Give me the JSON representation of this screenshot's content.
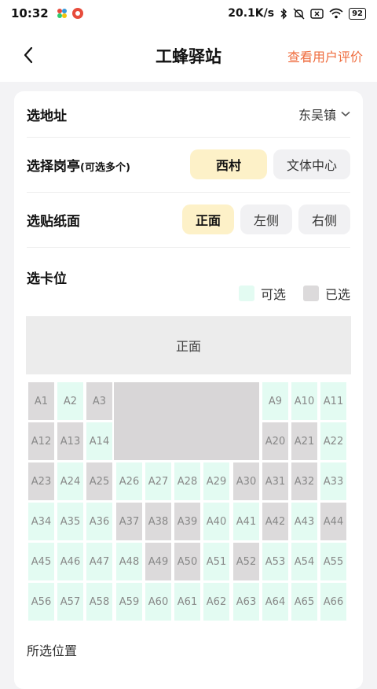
{
  "status": {
    "time": "10:32",
    "speed": "20.1K/s",
    "battery": "92",
    "left_icons": [
      "pinwheel-app-icon",
      "red-app-icon"
    ],
    "right_icons": [
      "bluetooth-icon",
      "mute-bell-icon",
      "close-box-icon",
      "wifi-icon",
      "battery-icon"
    ]
  },
  "nav": {
    "title": "工蜂驿站",
    "action": "查看用户评价"
  },
  "address": {
    "label": "选地址",
    "value": "东吴镇"
  },
  "kiosk": {
    "label": "选择岗亭",
    "hint": "(可选多个)",
    "options": [
      {
        "label": "西村",
        "selected": true
      },
      {
        "label": "文体中心",
        "selected": false
      }
    ]
  },
  "side": {
    "label": "选贴纸面",
    "options": [
      {
        "label": "正面",
        "selected": true
      },
      {
        "label": "左侧",
        "selected": false
      },
      {
        "label": "右侧",
        "selected": false
      }
    ]
  },
  "slots": {
    "label": "选卡位",
    "legend": {
      "available": "可选",
      "taken": "已选"
    },
    "front_label": "正面",
    "cells": [
      {
        "id": "A1",
        "status": "taken"
      },
      {
        "id": "A2",
        "status": "available"
      },
      {
        "id": "A3",
        "status": "taken"
      },
      {
        "id": "A9",
        "status": "available"
      },
      {
        "id": "A10",
        "status": "available"
      },
      {
        "id": "A11",
        "status": "available"
      },
      {
        "id": "A12",
        "status": "taken"
      },
      {
        "id": "A13",
        "status": "taken"
      },
      {
        "id": "A14",
        "status": "available"
      },
      {
        "id": "A20",
        "status": "taken"
      },
      {
        "id": "A21",
        "status": "taken"
      },
      {
        "id": "A22",
        "status": "available"
      },
      {
        "id": "A23",
        "status": "taken"
      },
      {
        "id": "A24",
        "status": "available"
      },
      {
        "id": "A25",
        "status": "taken"
      },
      {
        "id": "A26",
        "status": "available"
      },
      {
        "id": "A27",
        "status": "available"
      },
      {
        "id": "A28",
        "status": "available"
      },
      {
        "id": "A29",
        "status": "available"
      },
      {
        "id": "A30",
        "status": "taken"
      },
      {
        "id": "A31",
        "status": "taken"
      },
      {
        "id": "A32",
        "status": "taken"
      },
      {
        "id": "A33",
        "status": "available"
      },
      {
        "id": "A34",
        "status": "available"
      },
      {
        "id": "A35",
        "status": "available"
      },
      {
        "id": "A36",
        "status": "available"
      },
      {
        "id": "A37",
        "status": "taken"
      },
      {
        "id": "A38",
        "status": "taken"
      },
      {
        "id": "A39",
        "status": "taken"
      },
      {
        "id": "A40",
        "status": "available"
      },
      {
        "id": "A41",
        "status": "available"
      },
      {
        "id": "A42",
        "status": "taken"
      },
      {
        "id": "A43",
        "status": "available"
      },
      {
        "id": "A44",
        "status": "taken"
      },
      {
        "id": "A45",
        "status": "available"
      },
      {
        "id": "A46",
        "status": "available"
      },
      {
        "id": "A47",
        "status": "available"
      },
      {
        "id": "A48",
        "status": "available"
      },
      {
        "id": "A49",
        "status": "taken"
      },
      {
        "id": "A50",
        "status": "taken"
      },
      {
        "id": "A51",
        "status": "available"
      },
      {
        "id": "A52",
        "status": "taken"
      },
      {
        "id": "A53",
        "status": "available"
      },
      {
        "id": "A54",
        "status": "available"
      },
      {
        "id": "A55",
        "status": "available"
      },
      {
        "id": "A56",
        "status": "available"
      },
      {
        "id": "A57",
        "status": "available"
      },
      {
        "id": "A58",
        "status": "available"
      },
      {
        "id": "A59",
        "status": "available"
      },
      {
        "id": "A60",
        "status": "available"
      },
      {
        "id": "A61",
        "status": "available"
      },
      {
        "id": "A62",
        "status": "available"
      },
      {
        "id": "A63",
        "status": "available"
      },
      {
        "id": "A64",
        "status": "available"
      },
      {
        "id": "A65",
        "status": "available"
      },
      {
        "id": "A66",
        "status": "available"
      }
    ]
  },
  "selected": {
    "label": "所选位置"
  },
  "colors": {
    "accent": "#ef6c3e",
    "selected_option": "#fdf1c8",
    "available": "#e3fbf2",
    "taken": "#dcdadb"
  }
}
